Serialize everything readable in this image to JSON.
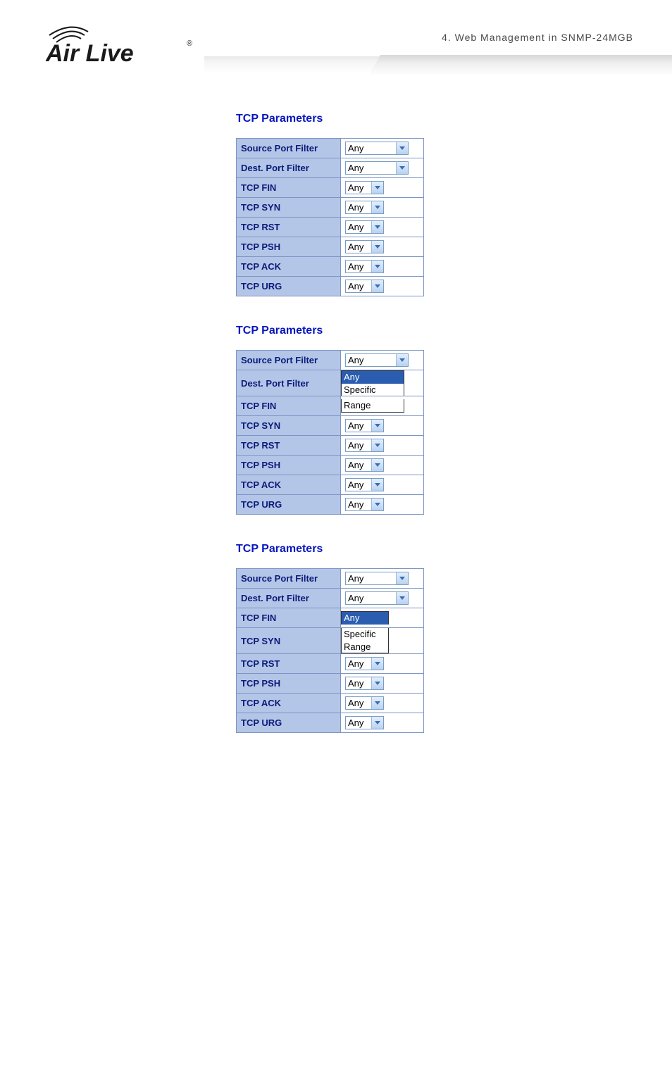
{
  "breadcrumb": "4.  Web  Management  in  SNMP-24MGB",
  "logo_alt": "Air Live",
  "sections": [
    {
      "title": "TCP Parameters",
      "rows": [
        {
          "label": "Source Port Filter",
          "mode": "dropdown",
          "width": "wide",
          "value": "Any"
        },
        {
          "label": "Dest. Port Filter",
          "mode": "dropdown",
          "width": "wide",
          "value": "Any"
        },
        {
          "label": "TCP FIN",
          "mode": "dropdown",
          "width": "narrow",
          "value": "Any"
        },
        {
          "label": "TCP SYN",
          "mode": "dropdown",
          "width": "narrow",
          "value": "Any"
        },
        {
          "label": "TCP RST",
          "mode": "dropdown",
          "width": "narrow",
          "value": "Any"
        },
        {
          "label": "TCP PSH",
          "mode": "dropdown",
          "width": "narrow",
          "value": "Any"
        },
        {
          "label": "TCP ACK",
          "mode": "dropdown",
          "width": "narrow",
          "value": "Any"
        },
        {
          "label": "TCP URG",
          "mode": "dropdown",
          "width": "narrow",
          "value": "Any"
        }
      ]
    },
    {
      "title": "TCP Parameters",
      "rows": [
        {
          "label": "Source Port Filter",
          "mode": "open-first",
          "width": "wide",
          "value": "Any",
          "selected": "Any"
        },
        {
          "label": "Dest. Port Filter",
          "mode": "open-line2",
          "width": "wide",
          "value": "Specific"
        },
        {
          "label": "TCP FIN",
          "mode": "open-line3",
          "width": "wide",
          "value": "Range"
        },
        {
          "label": "TCP SYN",
          "mode": "dropdown",
          "width": "narrow",
          "value": "Any"
        },
        {
          "label": "TCP RST",
          "mode": "dropdown",
          "width": "narrow",
          "value": "Any"
        },
        {
          "label": "TCP PSH",
          "mode": "dropdown",
          "width": "narrow",
          "value": "Any"
        },
        {
          "label": "TCP ACK",
          "mode": "dropdown",
          "width": "narrow",
          "value": "Any"
        },
        {
          "label": "TCP URG",
          "mode": "dropdown",
          "width": "narrow",
          "value": "Any"
        }
      ]
    },
    {
      "title": "TCP Parameters",
      "rows": [
        {
          "label": "Source Port Filter",
          "mode": "dropdown",
          "width": "wide",
          "value": "Any"
        },
        {
          "label": "Dest. Port Filter",
          "mode": "dropdown",
          "width": "wide",
          "value": "Any"
        },
        {
          "label": "TCP FIN",
          "mode": "open-first-n",
          "width": "narrow",
          "value": "Any",
          "selected": "Any"
        },
        {
          "label": "TCP SYN",
          "mode": "open-line2-n",
          "width": "narrow",
          "value": "Specific"
        },
        {
          "label": "",
          "mode": "open-line3-n",
          "width": "narrow",
          "value": "Range",
          "hidden_label": true
        },
        {
          "label": "TCP RST",
          "mode": "dropdown",
          "width": "narrow",
          "value": "Any"
        },
        {
          "label": "TCP PSH",
          "mode": "dropdown",
          "width": "narrow",
          "value": "Any"
        },
        {
          "label": "TCP ACK",
          "mode": "dropdown",
          "width": "narrow",
          "value": "Any"
        },
        {
          "label": "TCP URG",
          "mode": "dropdown",
          "width": "narrow",
          "value": "Any"
        }
      ]
    }
  ],
  "dropdown_options_wide": [
    "Any",
    "Specific",
    "Range"
  ],
  "dropdown_options_narrow": [
    "Any",
    "Specific",
    "Range"
  ]
}
